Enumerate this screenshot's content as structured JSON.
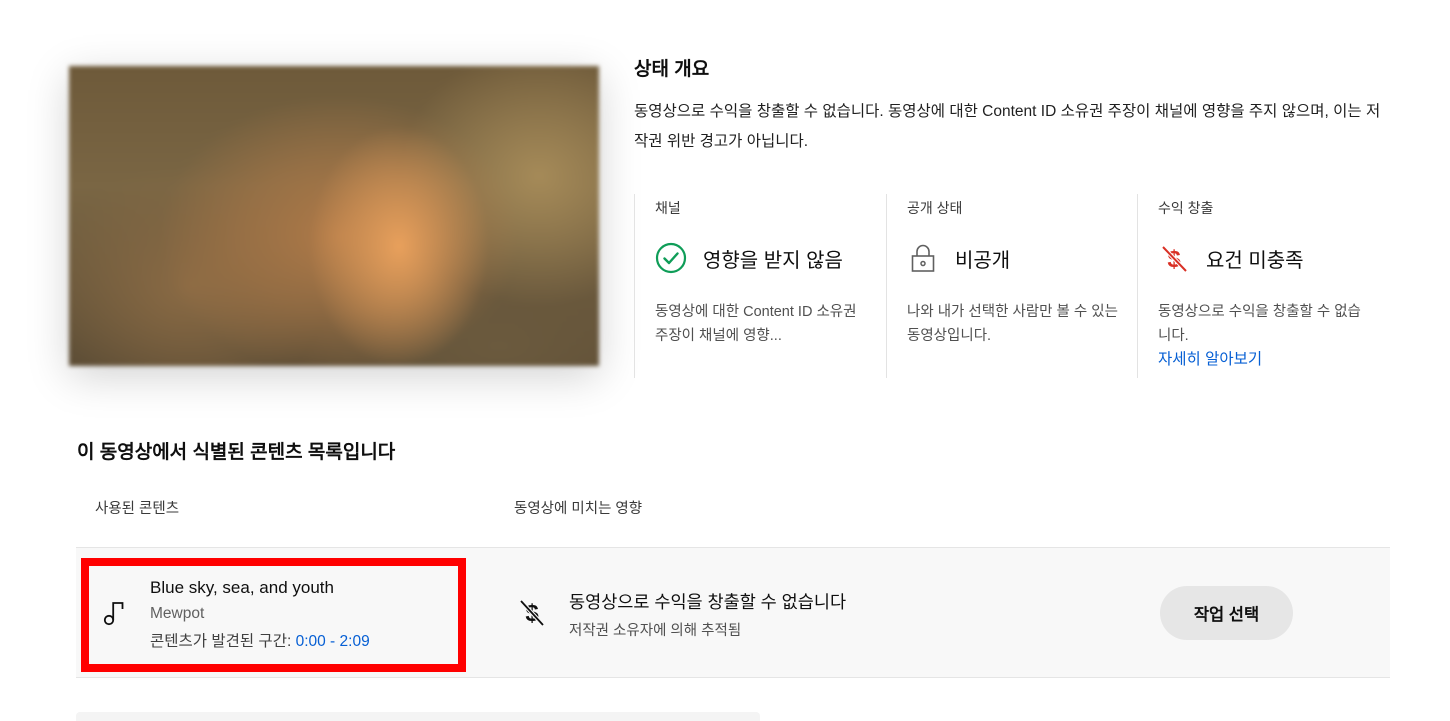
{
  "status": {
    "title": "상태 개요",
    "description": "동영상으로 수익을 창출할 수 없습니다. 동영상에 대한 Content ID 소유권 주장이 채널에 영향을 주지 않으며, 이는 저작권 위반 경고가 아닙니다."
  },
  "columns": {
    "channel": {
      "label": "채널",
      "value": "영향을 받지 않음",
      "description": "동영상에 대한 Content ID 소유권 주장이 채널에 영향...",
      "icon": "check-circle-icon",
      "icon_color": "#0f9d58"
    },
    "visibility": {
      "label": "공개 상태",
      "value": "비공개",
      "description": "나와 내가 선택한 사람만 볼 수 있는 동영상입니다.",
      "icon": "lock-icon"
    },
    "monetization": {
      "label": "수익 창출",
      "value": "요건 미충족",
      "description": "동영상으로 수익을 창출할 수 없습니다.",
      "link": "자세히 알아보기",
      "icon": "no-dollar-icon",
      "icon_color": "#d93025",
      "link_color": "#065fd4"
    }
  },
  "content_section": {
    "title": "이 동영상에서 식별된 콘텐츠 목록입니다",
    "header_used": "사용된 콘텐츠",
    "header_effect": "동영상에 미치는 영향",
    "rows": [
      {
        "title": "Blue sky, sea, and youth",
        "artist": "Mewpot",
        "range_label": "콘텐츠가 발견된 구간: ",
        "range_time": "0:00 - 2:09",
        "effect_title": "동영상으로 수익을 창출할 수 없습니다",
        "effect_sub": "저작권 소유자에 의해 추적됨",
        "action": "작업 선택",
        "icon": "music-note-icon",
        "effect_icon": "no-dollar-icon"
      }
    ]
  },
  "highlight_color": "#ff0000"
}
